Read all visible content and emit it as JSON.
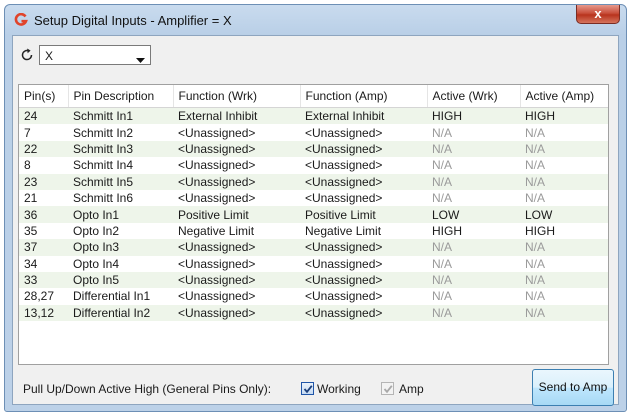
{
  "window": {
    "title": "Setup Digital Inputs - Amplifier = X",
    "close_label": "x"
  },
  "toolbar": {
    "refresh_icon": "refresh-icon",
    "axis_select_value": "X"
  },
  "table": {
    "headers": [
      "Pin(s)",
      "Pin Description",
      "Function (Wrk)",
      "Function (Amp)",
      "Active (Wrk)",
      "Active (Amp)"
    ],
    "rows": [
      {
        "pins": "24",
        "desc": "Schmitt In1",
        "func_wrk": "External Inhibit",
        "func_amp": "External Inhibit",
        "act_wrk": "HIGH",
        "act_amp": "HIGH"
      },
      {
        "pins": "7",
        "desc": "Schmitt In2",
        "func_wrk": "<Unassigned>",
        "func_amp": "<Unassigned>",
        "act_wrk": "N/A",
        "act_amp": "N/A"
      },
      {
        "pins": "22",
        "desc": "Schmitt In3",
        "func_wrk": "<Unassigned>",
        "func_amp": "<Unassigned>",
        "act_wrk": "N/A",
        "act_amp": "N/A"
      },
      {
        "pins": "8",
        "desc": "Schmitt In4",
        "func_wrk": "<Unassigned>",
        "func_amp": "<Unassigned>",
        "act_wrk": "N/A",
        "act_amp": "N/A"
      },
      {
        "pins": "23",
        "desc": "Schmitt In5",
        "func_wrk": "<Unassigned>",
        "func_amp": "<Unassigned>",
        "act_wrk": "N/A",
        "act_amp": "N/A"
      },
      {
        "pins": "21",
        "desc": "Schmitt In6",
        "func_wrk": "<Unassigned>",
        "func_amp": "<Unassigned>",
        "act_wrk": "N/A",
        "act_amp": "N/A"
      },
      {
        "pins": "36",
        "desc": "Opto In1",
        "func_wrk": "Positive Limit",
        "func_amp": "Positive Limit",
        "act_wrk": "LOW",
        "act_amp": "LOW"
      },
      {
        "pins": "35",
        "desc": "Opto In2",
        "func_wrk": "Negative Limit",
        "func_amp": "Negative Limit",
        "act_wrk": "HIGH",
        "act_amp": "HIGH"
      },
      {
        "pins": "37",
        "desc": "Opto In3",
        "func_wrk": "<Unassigned>",
        "func_amp": "<Unassigned>",
        "act_wrk": "N/A",
        "act_amp": "N/A"
      },
      {
        "pins": "34",
        "desc": "Opto In4",
        "func_wrk": "<Unassigned>",
        "func_amp": "<Unassigned>",
        "act_wrk": "N/A",
        "act_amp": "N/A"
      },
      {
        "pins": "33",
        "desc": "Opto In5",
        "func_wrk": "<Unassigned>",
        "func_amp": "<Unassigned>",
        "act_wrk": "N/A",
        "act_amp": "N/A"
      },
      {
        "pins": "28,27",
        "desc": "Differential In1",
        "func_wrk": "<Unassigned>",
        "func_amp": "<Unassigned>",
        "act_wrk": "N/A",
        "act_amp": "N/A"
      },
      {
        "pins": "13,12",
        "desc": "Differential In2",
        "func_wrk": "<Unassigned>",
        "func_amp": "<Unassigned>",
        "act_wrk": "N/A",
        "act_amp": "N/A"
      }
    ]
  },
  "footer": {
    "pull_label": "Pull Up/Down Active High (General Pins Only):",
    "working_label": "Working",
    "working_checked": true,
    "amp_label": "Amp",
    "amp_checked": true,
    "send_button": "Send to Amp"
  },
  "colors": {
    "alt_row": "#eef5ea",
    "na_text": "#9a9a9a",
    "title_icon": "#e0442b"
  }
}
